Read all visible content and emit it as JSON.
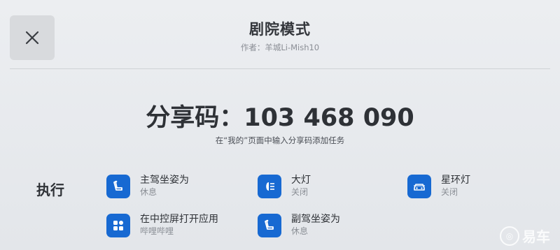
{
  "header": {
    "title": "剧院模式",
    "author": "作者：羊城Li-Mish10"
  },
  "share": {
    "code_text": "分享码：103 468 090",
    "hint": "在“我的”页面中输入分享码添加任务"
  },
  "execute": {
    "label": "执行",
    "actions": [
      {
        "name": "主驾坐姿为",
        "state": "休息",
        "icon": "seat-icon"
      },
      {
        "name": "大灯",
        "state": "关闭",
        "icon": "headlight-icon"
      },
      {
        "name": "星环灯",
        "state": "关闭",
        "icon": "car-light-icon"
      },
      {
        "name": "在中控屏打开应用",
        "state": "哔哩哔哩",
        "icon": "apps-icon"
      },
      {
        "name": "副驾坐姿为",
        "state": "休息",
        "icon": "seat-icon"
      }
    ]
  },
  "watermark": {
    "text": "易车",
    "symbol": "◎"
  },
  "colors": {
    "accent": "#1769d2",
    "background": "#e6e8eb"
  }
}
